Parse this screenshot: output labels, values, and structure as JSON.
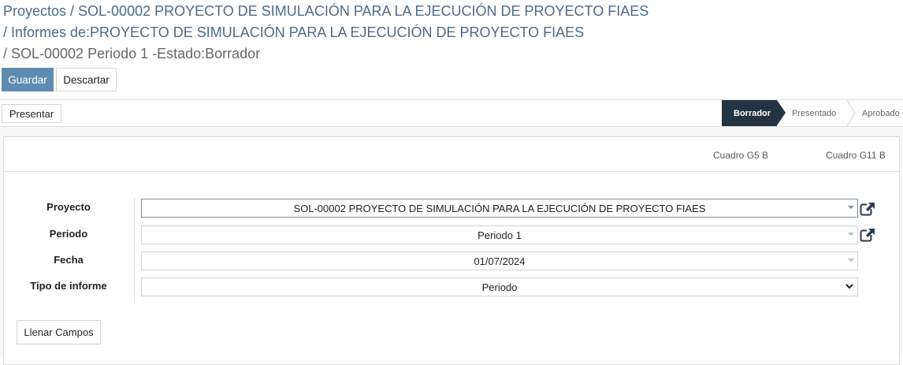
{
  "breadcrumb": {
    "line1": "Proyectos / SOL-00002 PROYECTO DE SIMULACIÓN PARA LA EJECUCIÓN DE PROYECTO FIAES",
    "line2": " / Informes de:PROYECTO DE SIMULACIÓN PARA LA EJECUCIÓN DE PROYECTO FIAES",
    "line3": " / SOL-00002 Periodo 1 -Estado:Borrador"
  },
  "control_panel": {
    "save_label": "Guardar",
    "discard_label": "Descartar"
  },
  "statusbar": {
    "action_label": "Presentar",
    "stages": [
      "Borrador",
      "Presentado",
      "Aprobado"
    ],
    "active_stage": "Borrador",
    "active_color": "#243342"
  },
  "smart_buttons": [
    "Cuadro G5 B",
    "Cuadro G11 B"
  ],
  "form": {
    "fields": [
      {
        "label": "Proyecto",
        "value": "SOL-00002 PROYECTO DE SIMULACIÓN PARA LA EJECUCIÓN DE PROYECTO FIAES"
      },
      {
        "label": "Periodo",
        "value": "Periodo 1"
      },
      {
        "label": "Fecha",
        "value": "01/07/2024"
      },
      {
        "label": "Tipo de informe",
        "value": "Periodo"
      }
    ],
    "fill_button_label": "Llenar Campos"
  },
  "icons": [
    "external-link-icon",
    "dropdown-caret-icon",
    "chevron-down-icon"
  ],
  "colors": {
    "primary": "#5f8bb0",
    "link": "#4c6b8a"
  }
}
